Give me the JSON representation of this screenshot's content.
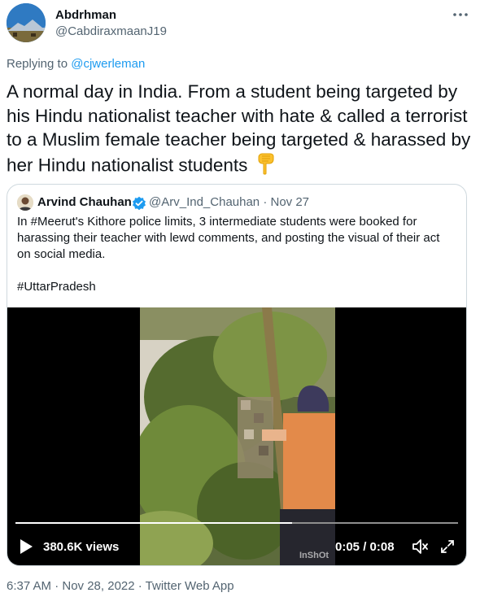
{
  "author": {
    "name": "Abdrhman",
    "handle": "@CabdiraxmaanJ19"
  },
  "replying": {
    "prefix": "Replying to ",
    "handle": "@cjwerleman"
  },
  "tweet": {
    "text": "A normal day in India. From a student being targeted by his Hindu nationalist teacher with hate & called a terrorist to a Muslim female teacher being targeted & harassed by her Hindu nationalist students",
    "emoji": "pointing-down-emoji"
  },
  "quoted": {
    "name": "Arvind Chauhan",
    "handle": "@Arv_Ind_Chauhan",
    "separator": "·",
    "date": "Nov 27",
    "text": "In #Meerut's Kithore police limits, 3 intermediate students were booked for harassing their teacher with lewd comments, and posting the visual of their act on social media.",
    "hashtag": "#UttarPradesh",
    "video": {
      "views": "380.6K views",
      "time": "0:05 / 0:08",
      "progress": 0.625,
      "watermark": "InShOt"
    }
  },
  "footer": {
    "timestamp": "6:37 AM · Nov 28, 2022 · Twitter Web App"
  },
  "colors": {
    "link": "#1d9bf0",
    "muted": "#536471",
    "text": "#0f1419",
    "border": "#cfd9de"
  }
}
